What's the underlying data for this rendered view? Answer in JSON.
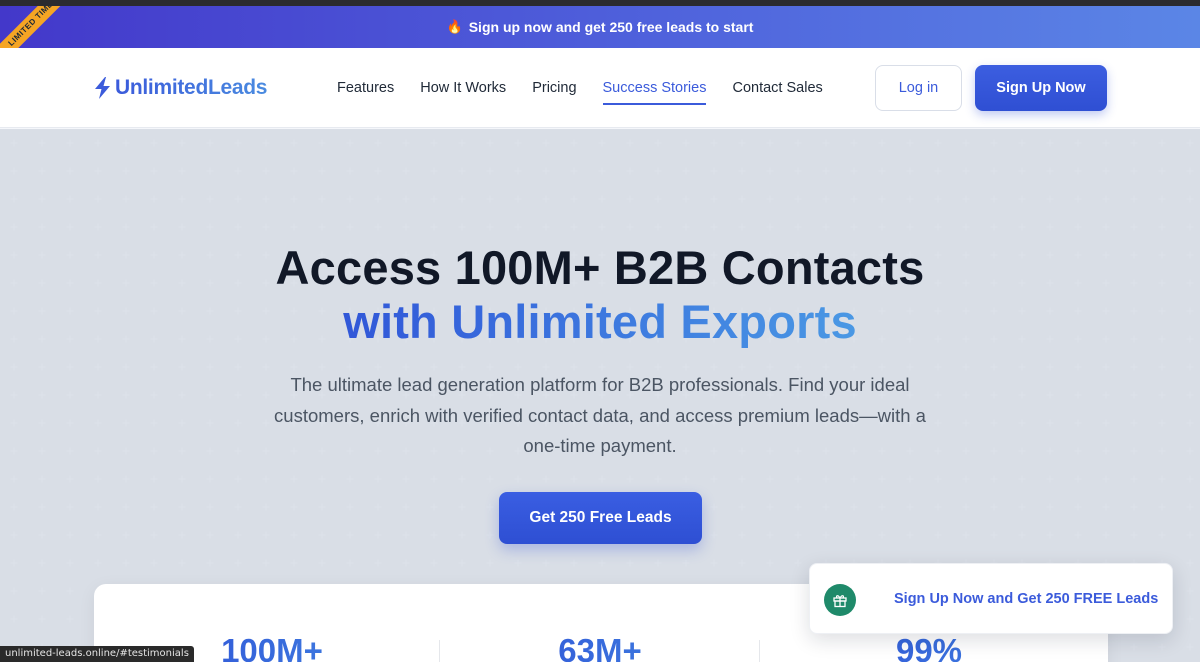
{
  "promo": {
    "ribbon_label": "LIMITED TIME",
    "fire_icon": "🔥",
    "text": "Sign up now and get 250 free leads to start"
  },
  "nav": {
    "logo_text": "UnlimitedLeads",
    "logo_icon": "lightning-bolt-icon",
    "links": [
      {
        "label": "Features",
        "active": false
      },
      {
        "label": "How It Works",
        "active": false
      },
      {
        "label": "Pricing",
        "active": false
      },
      {
        "label": "Success Stories",
        "active": true
      },
      {
        "label": "Contact Sales",
        "active": false
      }
    ],
    "login_label": "Log in",
    "signup_label": "Sign Up Now"
  },
  "hero": {
    "title_line1": "Access 100M+ B2B Contacts",
    "title_line2": "with Unlimited Exports",
    "subtitle": "The ultimate lead generation platform for B2B professionals. Find your ideal customers, enrich with verified contact data, and access premium leads—with a one-time payment.",
    "cta_label": "Get 250 Free Leads"
  },
  "stats": [
    {
      "value": "100M+"
    },
    {
      "value": "63M+"
    },
    {
      "value": "99%"
    }
  ],
  "toast": {
    "icon": "gift-icon",
    "text": "Sign Up Now and Get 250 FREE Leads"
  },
  "status_bar": {
    "url": "unlimited-leads.online/#testimonials"
  },
  "colors": {
    "brand": "#3b5bdb",
    "promo_start": "#4338ca",
    "promo_end": "#5b86e6",
    "ribbon": "#f5a524",
    "toast_icon_bg": "#1f8a6a"
  }
}
